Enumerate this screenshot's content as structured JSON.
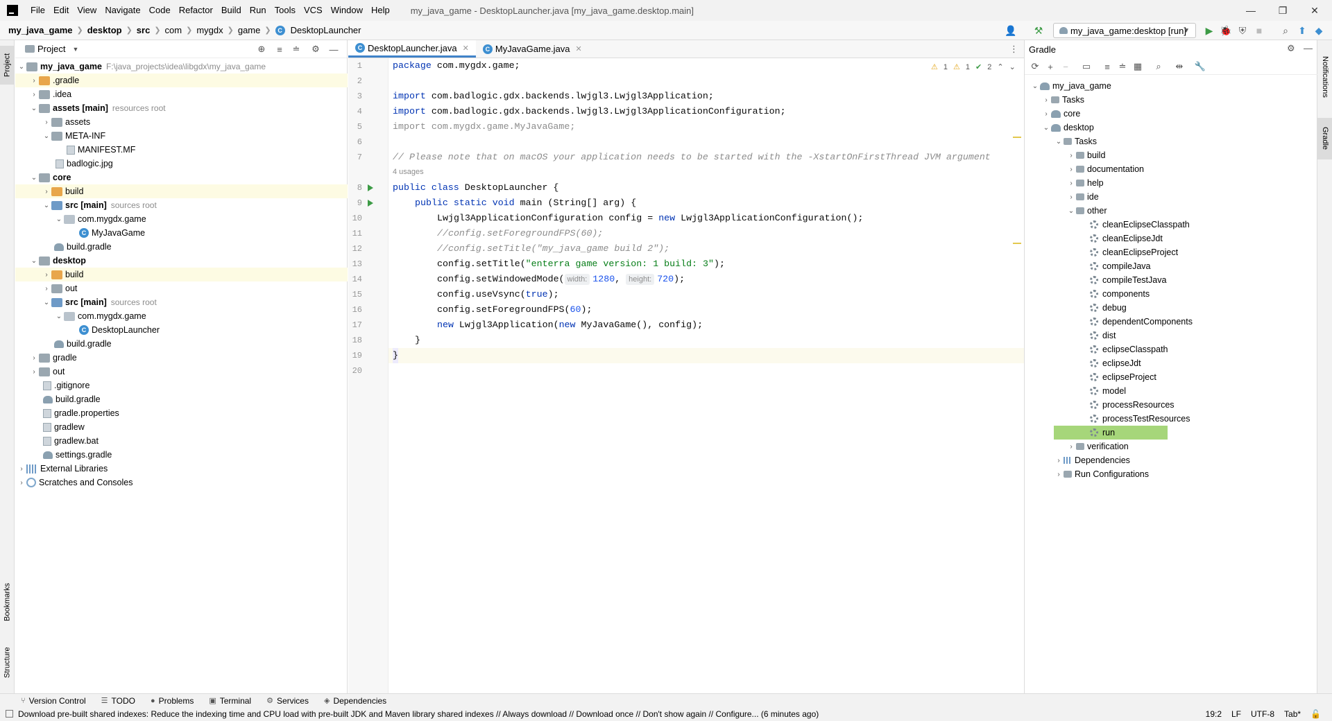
{
  "menu": [
    "File",
    "Edit",
    "View",
    "Navigate",
    "Code",
    "Refactor",
    "Build",
    "Run",
    "Tools",
    "VCS",
    "Window",
    "Help"
  ],
  "window_title": "my_java_game - DesktopLauncher.java [my_java_game.desktop.main]",
  "window_controls": {
    "minimize": "—",
    "maximize": "❐",
    "close": "✕"
  },
  "breadcrumbs": [
    "my_java_game",
    "desktop",
    "src",
    "com",
    "mygdx",
    "game",
    "DesktopLauncher"
  ],
  "run_config": "my_java_game:desktop [run]",
  "left_strip": {
    "project": "Project",
    "bookmarks": "Bookmarks",
    "structure": "Structure"
  },
  "right_strip": {
    "notifications": "Notifications",
    "gradle": "Gradle"
  },
  "project_panel": {
    "title": "Project",
    "tree": [
      {
        "label": "my_java_game",
        "hint": "F:\\java_projects\\idea\\libgdx\\my_java_game"
      },
      {
        "label": ".gradle"
      },
      {
        "label": ".idea"
      },
      {
        "label": "assets [main]",
        "hint": "resources root"
      },
      {
        "label": "assets"
      },
      {
        "label": "META-INF"
      },
      {
        "label": "MANIFEST.MF"
      },
      {
        "label": "badlogic.jpg"
      },
      {
        "label": "core"
      },
      {
        "label": "build"
      },
      {
        "label": "src [main]",
        "hint": "sources root"
      },
      {
        "label": "com.mygdx.game"
      },
      {
        "label": "MyJavaGame"
      },
      {
        "label": "build.gradle"
      },
      {
        "label": "desktop"
      },
      {
        "label": "build"
      },
      {
        "label": "out"
      },
      {
        "label": "src [main]",
        "hint": "sources root"
      },
      {
        "label": "com.mygdx.game"
      },
      {
        "label": "DesktopLauncher"
      },
      {
        "label": "build.gradle"
      },
      {
        "label": "gradle"
      },
      {
        "label": "out"
      },
      {
        "label": ".gitignore"
      },
      {
        "label": "build.gradle"
      },
      {
        "label": "gradle.properties"
      },
      {
        "label": "gradlew"
      },
      {
        "label": "gradlew.bat"
      },
      {
        "label": "settings.gradle"
      },
      {
        "label": "External Libraries"
      },
      {
        "label": "Scratches and Consoles"
      }
    ]
  },
  "editor": {
    "tabs": [
      {
        "label": "DesktopLauncher.java"
      },
      {
        "label": "MyJavaGame.java"
      }
    ],
    "inspections": {
      "warnings": "1",
      "weak_warnings": "1",
      "ok": "2"
    },
    "usages": "4 usages",
    "line_numbers": [
      "1",
      "2",
      "3",
      "4",
      "5",
      "6",
      "7",
      "8",
      "9",
      "10",
      "11",
      "12",
      "13",
      "14",
      "15",
      "16",
      "17",
      "18",
      "19",
      "20"
    ],
    "code": {
      "l1_kw": "package",
      "l1_rest": " com.mygdx.game;",
      "l3_kw": "import",
      "l3_rest": " com.badlogic.gdx.backends.lwjgl3.Lwjgl3Application;",
      "l4_kw": "import",
      "l4_rest": " com.badlogic.gdx.backends.lwjgl3.Lwjgl3ApplicationConfiguration;",
      "l5": "import com.mygdx.game.MyJavaGame;",
      "l7": "// Please note that on macOS your application needs to be started with the -XstartOnFirstThread JVM argument",
      "l8_kw": "public class",
      "l8_rest": " DesktopLauncher {",
      "l9_kw": "public static void",
      "l9_rest": " main (String[] arg) {",
      "l10_a": "Lwjgl3ApplicationConfiguration config = ",
      "l10_kw": "new",
      "l10_b": " Lwjgl3ApplicationConfiguration();",
      "l11": "//config.setForegroundFPS(60);",
      "l12": "//config.setTitle(\"my_java_game build 2\");",
      "l13_a": "config.setTitle(",
      "l13_str": "\"enterra game version: 1 build: 3\"",
      "l13_b": ");",
      "l14_a": "config.setWindowedMode(",
      "l14_h1": "width:",
      "l14_n1": "1280",
      "l14_c": ", ",
      "l14_h2": "height:",
      "l14_n2": "720",
      "l14_b": ");",
      "l15_a": "config.useVsync(",
      "l15_kw": "true",
      "l15_b": ");",
      "l16_a": "config.setForegroundFPS(",
      "l16_num": "60",
      "l16_b": ");",
      "l17_kw1": "new",
      "l17_a": " Lwjgl3Application(",
      "l17_kw2": "new",
      "l17_b": " MyJavaGame(), config);",
      "l18": "}",
      "l19": "}"
    }
  },
  "gradle_panel": {
    "title": "Gradle",
    "tree": [
      {
        "label": "my_java_game"
      },
      {
        "label": "Tasks"
      },
      {
        "label": "core"
      },
      {
        "label": "desktop"
      },
      {
        "label": "Tasks"
      },
      {
        "label": "build"
      },
      {
        "label": "documentation"
      },
      {
        "label": "help"
      },
      {
        "label": "ide"
      },
      {
        "label": "other"
      },
      {
        "label": "cleanEclipseClasspath"
      },
      {
        "label": "cleanEclipseJdt"
      },
      {
        "label": "cleanEclipseProject"
      },
      {
        "label": "compileJava"
      },
      {
        "label": "compileTestJava"
      },
      {
        "label": "components"
      },
      {
        "label": "debug"
      },
      {
        "label": "dependentComponents"
      },
      {
        "label": "dist"
      },
      {
        "label": "eclipseClasspath"
      },
      {
        "label": "eclipseJdt"
      },
      {
        "label": "eclipseProject"
      },
      {
        "label": "model"
      },
      {
        "label": "processResources"
      },
      {
        "label": "processTestResources"
      },
      {
        "label": "run"
      },
      {
        "label": "verification"
      },
      {
        "label": "Dependencies"
      },
      {
        "label": "Run Configurations"
      }
    ]
  },
  "bottom_tools": [
    "Version Control",
    "TODO",
    "Problems",
    "Terminal",
    "Services",
    "Dependencies"
  ],
  "status": {
    "message": "Download pre-built shared indexes: Reduce the indexing time and CPU load with pre-built JDK and Maven library shared indexes // Always download // Download once // Don't show again // Configure... (6 minutes ago)",
    "position": "19:2",
    "line_sep": "LF",
    "encoding": "UTF-8",
    "indent": "Tab*"
  }
}
